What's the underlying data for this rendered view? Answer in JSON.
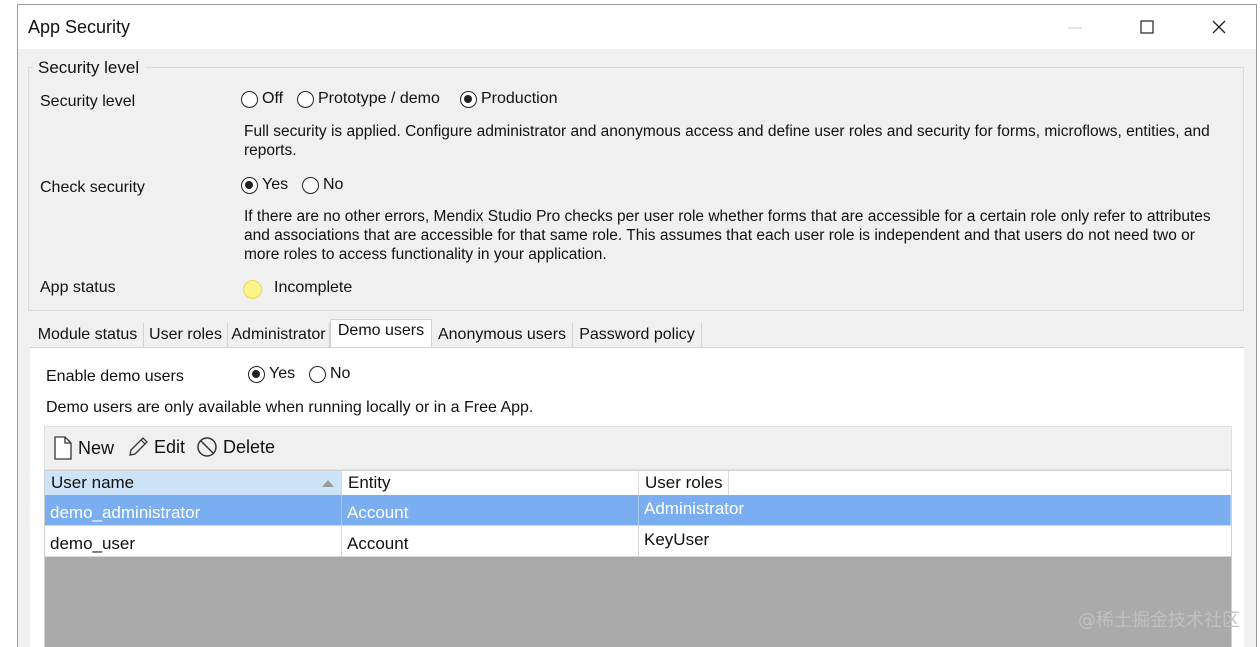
{
  "window": {
    "title": "App Security"
  },
  "security_group": {
    "legend": "Security level",
    "security_level": {
      "label": "Security level",
      "options": [
        "Off",
        "Prototype / demo",
        "Production"
      ],
      "selected": "Production",
      "description": "Full security is applied. Configure administrator and anonymous access and define user roles and security for forms, microflows, entities, and reports."
    },
    "check_security": {
      "label": "Check security",
      "options": [
        "Yes",
        "No"
      ],
      "selected": "Yes",
      "description": "If there are no other errors, Mendix Studio Pro checks per user role whether forms that are accessible for a certain role only refer to attributes and associations that are accessible for that same role. This assumes that each user role is independent and that users do not need two or more roles to access functionality in your application."
    },
    "app_status": {
      "label": "App status",
      "value": "Incomplete",
      "color": "#fbf38a"
    }
  },
  "tabs": [
    {
      "label": "Module status",
      "active": false
    },
    {
      "label": "User roles",
      "active": false
    },
    {
      "label": "Administrator",
      "active": false
    },
    {
      "label": "Demo users",
      "active": true
    },
    {
      "label": "Anonymous users",
      "active": false
    },
    {
      "label": "Password policy",
      "active": false
    }
  ],
  "demo_users": {
    "enable_label": "Enable demo users",
    "options": [
      "Yes",
      "No"
    ],
    "selected": "Yes",
    "note": "Demo users are only available when running locally or in a Free App.",
    "toolbar": {
      "new_label": "New",
      "edit_label": "Edit",
      "delete_label": "Delete"
    },
    "table": {
      "columns": [
        "User name",
        "Entity",
        "User roles"
      ],
      "sort_column": "User name",
      "rows": [
        {
          "user_name": "demo_administrator",
          "entity": "Account",
          "user_roles": "Administrator",
          "selected": true
        },
        {
          "user_name": "demo_user",
          "entity": "Account",
          "user_roles": "KeyUser",
          "selected": false
        }
      ]
    }
  },
  "watermark": "@稀土掘金技术社区",
  "colors": {
    "selection": "#7aaef0",
    "header_sorted": "#cde3f7",
    "grid_empty": "#aaaaaa"
  }
}
